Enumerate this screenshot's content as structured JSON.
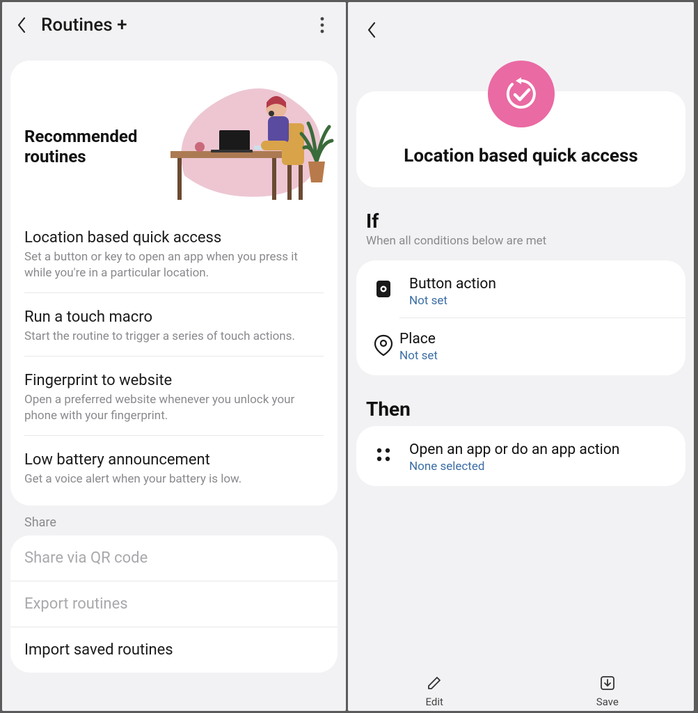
{
  "left": {
    "title": "Routines +",
    "hero_title": "Recommended routines",
    "routines": [
      {
        "title": "Location based quick access",
        "desc": "Set a button or key to open an app when you press it while you're in a particular location."
      },
      {
        "title": "Run a touch macro",
        "desc": "Start the routine to trigger a series of touch actions."
      },
      {
        "title": "Fingerprint to website",
        "desc": "Open a preferred website whenever you unlock your phone with your fingerprint."
      },
      {
        "title": "Low battery announcement",
        "desc": "Get a voice alert when your battery is low."
      }
    ],
    "share_label": "Share",
    "share_items": [
      {
        "label": "Share via QR code",
        "enabled": false
      },
      {
        "label": "Export routines",
        "enabled": false
      },
      {
        "label": "Import saved routines",
        "enabled": true
      }
    ]
  },
  "right": {
    "title": "Location based quick access",
    "if_label": "If",
    "if_sub": "When all conditions below are met",
    "conditions": [
      {
        "icon": "button-action-icon",
        "title": "Button action",
        "status": "Not set"
      },
      {
        "icon": "place-icon",
        "title": "Place",
        "status": "Not set"
      }
    ],
    "then_label": "Then",
    "actions": [
      {
        "icon": "apps-icon",
        "title": "Open an app or do an app action",
        "status": "None selected"
      }
    ],
    "bottom": {
      "edit": "Edit",
      "save": "Save"
    }
  }
}
